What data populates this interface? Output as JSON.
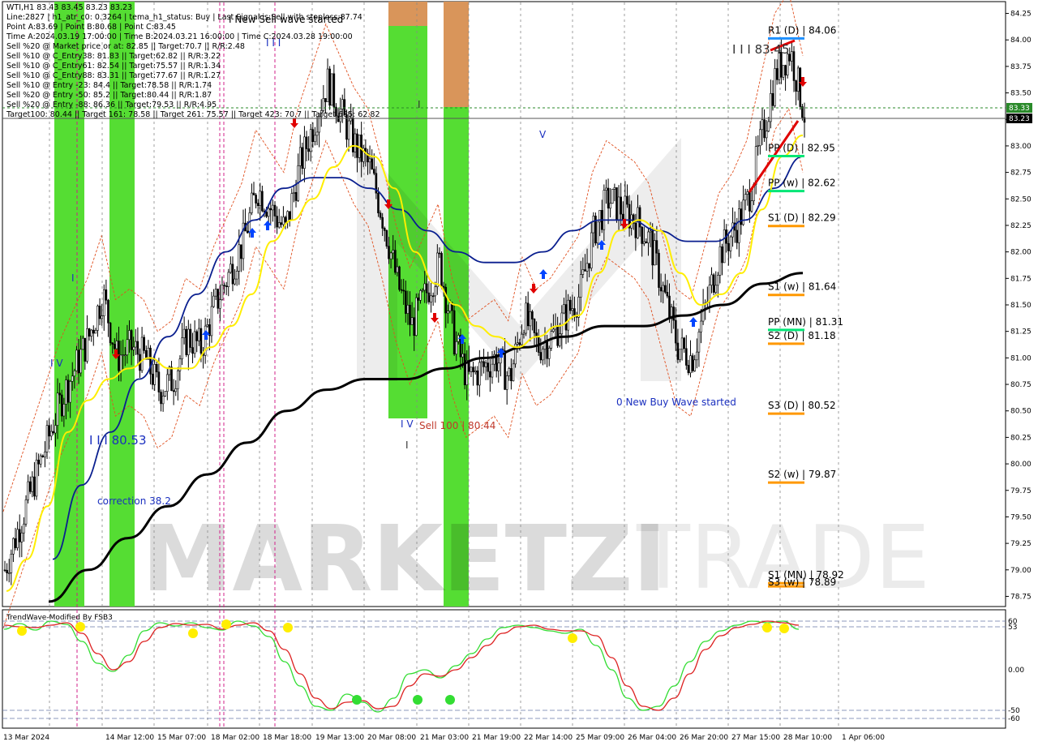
{
  "window": {
    "info_lines": [
      "WTI,H1  83.43 83.45 83.23 83.23",
      "Line:2827  |  h1_atr_c0: 0.3264  |  tema_h1_status: Buy  |  Last Signal is:Sell with stoploss:87.74",
      "Point A:83.69  |  Point B:80.68  |  Point C:83.45",
      "Time A:2024.03.19 17:00:00  |  Time B:2024.03.21 16:00:00  |  Time C:2024.03.28 19:00:00",
      "Sell %20 @ Market price or at: 82.85  ||  Target:70.7  ||  R/R:2.48",
      "Sell %10 @ C_Entry38: 81.83  ||  Target:62.82  ||  R/R:3.22",
      "Sell %10 @ C_Entry61: 82.54  ||  Target:75.57  ||  R/R:1.34",
      "Sell %10 @ C_Entry88: 83.31  ||  Target:77.67  ||  R/R:1.27",
      "Sell %10 @ Entry -23: 84.4  ||  Target:78.58  ||  R/R:1.74",
      "Sell %20 @ Entry -50: 85.2  ||  Target:80.44  ||  R/R:1.87",
      "Sell %20 @ Entry -88: 86.36  ||  Target:79.53  ||  R/R:4.95",
      "Target100: 80.44  ||  Target 161: 78.58  ||  Target 261: 75.57  ||  Target 423: 70.7  ||  Target 685: 62.82"
    ],
    "wave_label": "I New Sell wave started",
    "watermark_left": "MARKETZI",
    "watermark_right": "TRADE",
    "subpanel_title": "TrendWave-Modified By FSB3"
  },
  "annotations": {
    "top_wave": "I I I",
    "point_c_label": "I I I 83.45",
    "point_low_label": "I I I 80.53",
    "correction": "correction 38.2",
    "sell_target": "Sell 100 | 80.44",
    "buy_wave": "0 New Buy Wave started",
    "v_mark": "V",
    "i_mark": "I",
    "iv_mark": "I V",
    "point_b_mark": "I V"
  },
  "levels": [
    {
      "label": "R1 (D) | 84.06",
      "value": 84.06,
      "color": "#1e90ff"
    },
    {
      "label": "PP (D) | 82.95",
      "value": 82.95,
      "color": "#00e676"
    },
    {
      "label": "PP (w) | 82.62",
      "value": 82.62,
      "color": "#00e676"
    },
    {
      "label": "S1 (D) | 82.29",
      "value": 82.29,
      "color": "#ff9800"
    },
    {
      "label": "S1 (w) | 81.64",
      "value": 81.64,
      "color": "#ff9800"
    },
    {
      "label": "PP (MN) | 81.31",
      "value": 81.31,
      "color": "#00e676"
    },
    {
      "label": "S2 (D) | 81.18",
      "value": 81.18,
      "color": "#ff9800"
    },
    {
      "label": "S3 (D) | 80.52",
      "value": 80.52,
      "color": "#ff9800"
    },
    {
      "label": "S2 (w) | 79.87",
      "value": 79.87,
      "color": "#ff9800"
    },
    {
      "label": "S1 (MN) | 78.92",
      "value": 78.92,
      "color": "#ff9800"
    },
    {
      "label": "S3 (w) | 78.89",
      "value": 78.89,
      "color": "#ff9800"
    }
  ],
  "price_tags": {
    "bid": "83.33",
    "last": "83.23"
  },
  "colors": {
    "bull_zone": "#55dd33",
    "sell_zone": "#d9955a",
    "ema_yellow": "#ffee00",
    "ema_navy": "#0a1f8f",
    "sma_black": "#000000",
    "channel_red": "#e05020",
    "signal_red": "#e00000",
    "signal_blue": "#0044ff",
    "osc_green": "#33dd33",
    "osc_red": "#dd2222",
    "osc_dot": "#ffee00"
  },
  "chart_data": {
    "type": "candlestick",
    "symbol": "WTI",
    "timeframe": "H1",
    "ylim": [
      78.7,
      84.3
    ],
    "y_ticks": [
      "84.25",
      "84.00",
      "83.75",
      "83.50",
      "83.25",
      "83.00",
      "82.75",
      "82.50",
      "82.25",
      "82.00",
      "81.75",
      "81.50",
      "81.25",
      "81.00",
      "80.75",
      "80.50",
      "80.25",
      "80.00",
      "79.75",
      "79.50",
      "79.25",
      "79.00",
      "78.75"
    ],
    "x_labels": [
      "13 Mar 2024",
      "14 Mar 12:00",
      "15 Mar 07:00",
      "18 Mar 02:00",
      "18 Mar 18:00",
      "19 Mar 13:00",
      "20 Mar 08:00",
      "21 Mar 03:00",
      "21 Mar 19:00",
      "22 Mar 14:00",
      "25 Mar 09:00",
      "26 Mar 04:00",
      "26 Mar 20:00",
      "27 Mar 15:00",
      "28 Mar 10:00",
      "1 Apr 06:00"
    ],
    "close_path": [
      79.0,
      79.4,
      79.8,
      80.2,
      80.6,
      80.9,
      81.2,
      81.6,
      81.0,
      81.1,
      81.0,
      80.7,
      80.8,
      81.2,
      81.1,
      81.5,
      81.8,
      82.1,
      82.6,
      82.4,
      82.2,
      82.8,
      83.2,
      83.6,
      83.3,
      83.0,
      82.8,
      82.3,
      81.7,
      81.3,
      81.6,
      81.9,
      81.2,
      80.8,
      80.9,
      81.0,
      80.8,
      81.4,
      81.1,
      81.2,
      81.4,
      81.6,
      82.2,
      82.5,
      82.4,
      82.3,
      82.1,
      81.6,
      81.1,
      81.0,
      81.5,
      82.0,
      82.2,
      82.5,
      83.1,
      83.7,
      83.9,
      83.3
    ],
    "yellow_ema": [
      78.8,
      79.1,
      79.6,
      80.3,
      80.6,
      80.8,
      80.9,
      81.0,
      80.9,
      80.9,
      81.1,
      81.3,
      81.6,
      82.1,
      82.3,
      82.5,
      82.8,
      83.0,
      82.9,
      82.6,
      82.0,
      81.7,
      81.5,
      81.3,
      81.2,
      81.1,
      81.2,
      81.3,
      81.4,
      81.8,
      82.2,
      82.3,
      82.2,
      81.8,
      81.5,
      81.6,
      81.8,
      82.4,
      82.9,
      83.1
    ],
    "navy_ema": [
      79.1,
      79.8,
      80.3,
      80.8,
      81.2,
      81.6,
      82.0,
      82.3,
      82.6,
      82.7,
      82.7,
      82.6,
      82.4,
      82.2,
      82.0,
      81.9,
      81.9,
      82.0,
      82.2,
      82.3,
      82.3,
      82.2,
      82.1,
      82.1,
      82.3,
      82.6,
      82.9
    ],
    "black_sma": [
      78.7,
      79.0,
      79.3,
      79.6,
      79.9,
      80.2,
      80.5,
      80.7,
      80.8,
      80.8,
      80.9,
      81.0,
      81.1,
      81.2,
      81.3,
      81.3,
      81.4,
      81.5,
      81.7,
      81.8
    ],
    "oscillator": {
      "ylim": [
        -62,
        62
      ],
      "ticks": [
        "60",
        "53",
        "0.00",
        "-50",
        "-60"
      ],
      "green": [
        50,
        57,
        49,
        60,
        56,
        35,
        8,
        -2,
        18,
        48,
        58,
        54,
        58,
        52,
        49,
        60,
        54,
        41,
        10,
        -20,
        -45,
        -50,
        -30,
        -40,
        -52,
        -35,
        -5,
        0,
        -10,
        5,
        20,
        38,
        52,
        55,
        52,
        48,
        45,
        50,
        30,
        0,
        -35,
        -50,
        -45,
        -20,
        10,
        35,
        48,
        55,
        60,
        58,
        60,
        50
      ],
      "red": [
        55,
        53,
        52,
        55,
        58,
        45,
        20,
        0,
        10,
        35,
        52,
        57,
        55,
        56,
        50,
        55,
        58,
        48,
        25,
        -5,
        -35,
        -48,
        -40,
        -38,
        -48,
        -45,
        -20,
        -5,
        -8,
        0,
        15,
        30,
        45,
        53,
        55,
        50,
        48,
        48,
        42,
        15,
        -20,
        -45,
        -50,
        -35,
        -5,
        25,
        42,
        52,
        56,
        60,
        58,
        55
      ]
    }
  }
}
